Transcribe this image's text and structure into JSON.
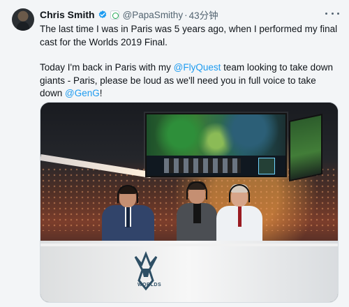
{
  "tweet": {
    "author": {
      "name": "Chris Smith",
      "handle": "@PapaSmithy",
      "timestamp": "43分钟",
      "dot": "·"
    },
    "body": {
      "paragraph_1": "The last time I was in Paris was 5 years ago, when I performed my final cast for the Worlds 2019 Final.",
      "paragraph_2_part_1": "Today I'm back in Paris with my ",
      "mention_1": "@FlyQuest",
      "paragraph_2_part_2": " team looking to take down giants - Paris, please be loud as we'll need you in full voice to take down ",
      "mention_2": "@GenG",
      "paragraph_2_end": "!"
    },
    "icons": {
      "avatar": "profile-photo",
      "verified": "verified-badge-icon",
      "affiliation": "affiliation-badge-icon",
      "more": "more-options-icon"
    }
  },
  "media": {
    "logo_text": "WORLDS"
  },
  "colors": {
    "background": "#f3f5f7",
    "text": "#0f1419",
    "secondary_text": "#536471",
    "link": "#1d9bf0",
    "verified": "#1d9bf0"
  }
}
